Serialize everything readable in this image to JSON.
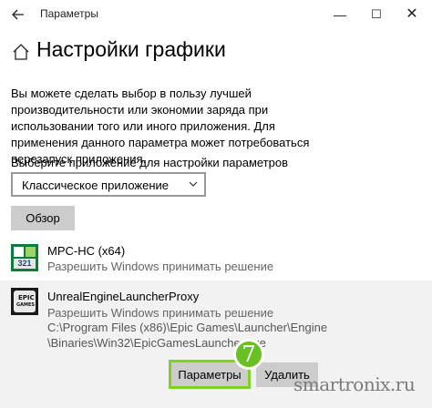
{
  "window": {
    "title": "Параметры",
    "back_icon": "back-arrow-icon",
    "minimize_glyph": "—",
    "maximize_glyph": "☐",
    "close_glyph": "✕"
  },
  "page": {
    "title": "Настройки графики",
    "description": "Вы можете сделать выбор в пользу лучшей производительности или экономии заряда при использовании того или иного приложения. Для применения данного параметра может потребоваться перезапуск приложения.",
    "select_label": "Выберите приложение для настройки параметров",
    "dropdown_value": "Классическое приложение",
    "browse_label": "Обзор"
  },
  "apps": [
    {
      "name": "MPC-HC (x64)",
      "status": "Разрешить Windows принимать решение",
      "icon": "mpc-hc-icon",
      "icon_text": "321"
    },
    {
      "name": "UnrealEngineLauncherProxy",
      "status": "Разрешить Windows принимать решение",
      "path_lines": [
        "C:\\Program Files (x86)\\Epic Games\\Launcher\\Engine",
        "\\Binaries\\Win32\\EpicGamesLauncher.exe"
      ],
      "icon": "epic-games-icon",
      "icon_text_1": "EPIC",
      "icon_text_2": "GAMES",
      "selected": true
    }
  ],
  "actions": {
    "settings_label": "Параметры",
    "delete_label": "Удалить"
  },
  "annotation": {
    "step_number": "7",
    "highlight_color": "#7cd12a"
  },
  "watermark": "smartronix.ru"
}
